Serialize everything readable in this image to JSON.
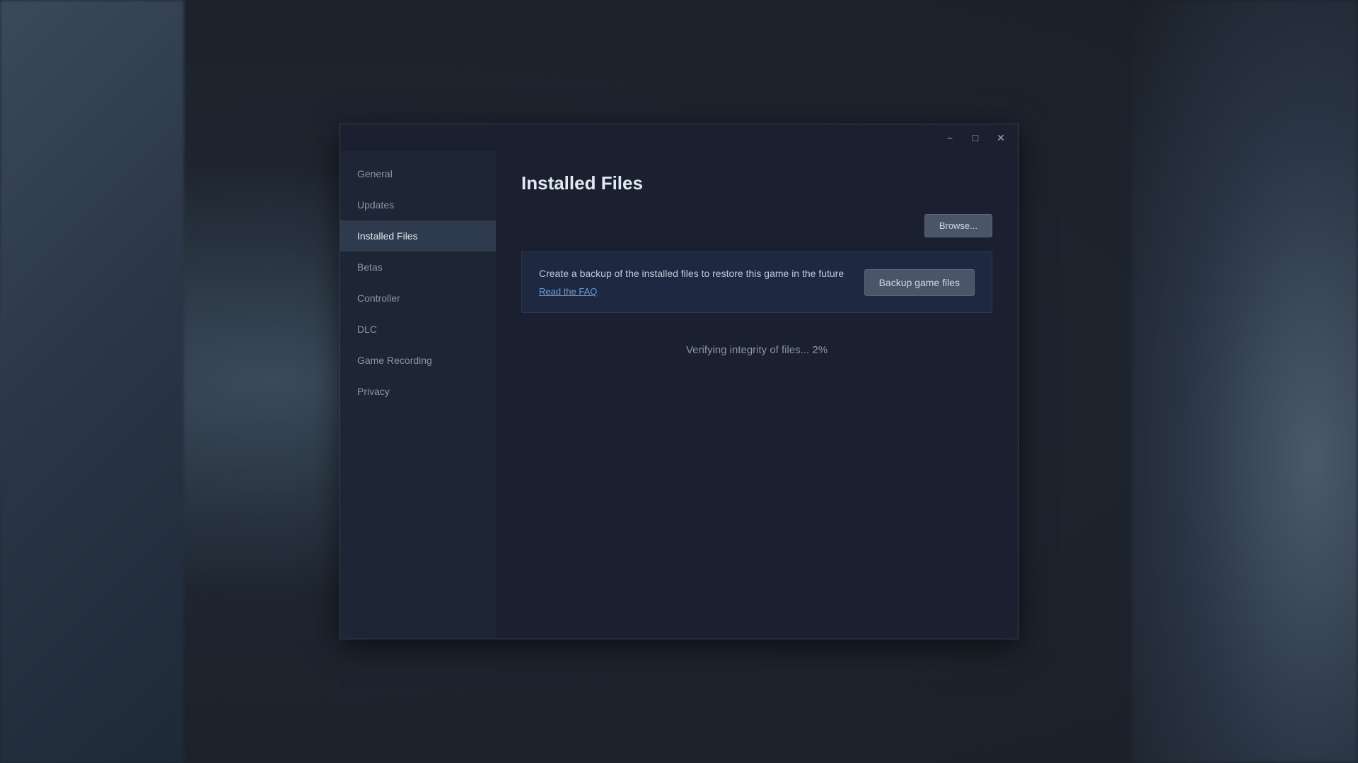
{
  "window": {
    "titlebar": {
      "minimize_label": "−",
      "maximize_label": "□",
      "close_label": "✕"
    }
  },
  "sidebar": {
    "items": [
      {
        "id": "general",
        "label": "General",
        "active": false
      },
      {
        "id": "updates",
        "label": "Updates",
        "active": false
      },
      {
        "id": "installed-files",
        "label": "Installed Files",
        "active": true
      },
      {
        "id": "betas",
        "label": "Betas",
        "active": false
      },
      {
        "id": "controller",
        "label": "Controller",
        "active": false
      },
      {
        "id": "dlc",
        "label": "DLC",
        "active": false
      },
      {
        "id": "game-recording",
        "label": "Game Recording",
        "active": false
      },
      {
        "id": "privacy",
        "label": "Privacy",
        "active": false
      }
    ]
  },
  "content": {
    "page_title": "Installed Files",
    "browse_button": "Browse...",
    "backup_desc": "Create a backup of the installed files to restore this game in the future",
    "backup_faq": "Read the FAQ",
    "backup_button": "Backup game files",
    "verify_status": "Verifying integrity of files... 2%"
  }
}
